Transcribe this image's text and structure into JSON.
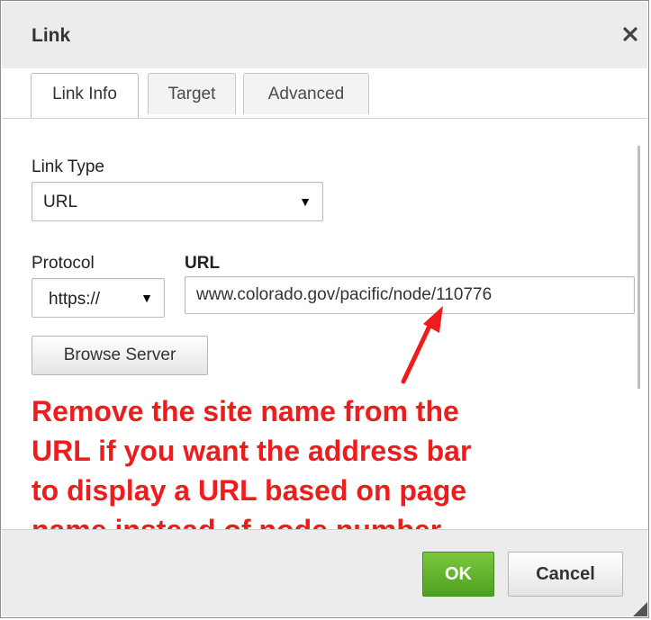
{
  "dialog": {
    "title": "Link",
    "close_icon": "close-icon"
  },
  "tabs": [
    {
      "label": "Link Info",
      "active": true
    },
    {
      "label": "Target",
      "active": false
    },
    {
      "label": "Advanced",
      "active": false
    }
  ],
  "form": {
    "link_type_label": "Link Type",
    "link_type_value": "URL",
    "protocol_label": "Protocol",
    "protocol_value": "https://",
    "url_label": "URL",
    "url_value": "www.colorado.gov/pacific/node/110776",
    "browse_server_label": "Browse Server"
  },
  "annotation": {
    "lines": [
      "Remove the site name from the",
      "URL if you want the address bar",
      "to display a URL based on page",
      "name instead of node number."
    ],
    "color": "#ee1c1c"
  },
  "footer": {
    "ok_label": "OK",
    "cancel_label": "Cancel",
    "ok_color": "#5aae2a"
  }
}
